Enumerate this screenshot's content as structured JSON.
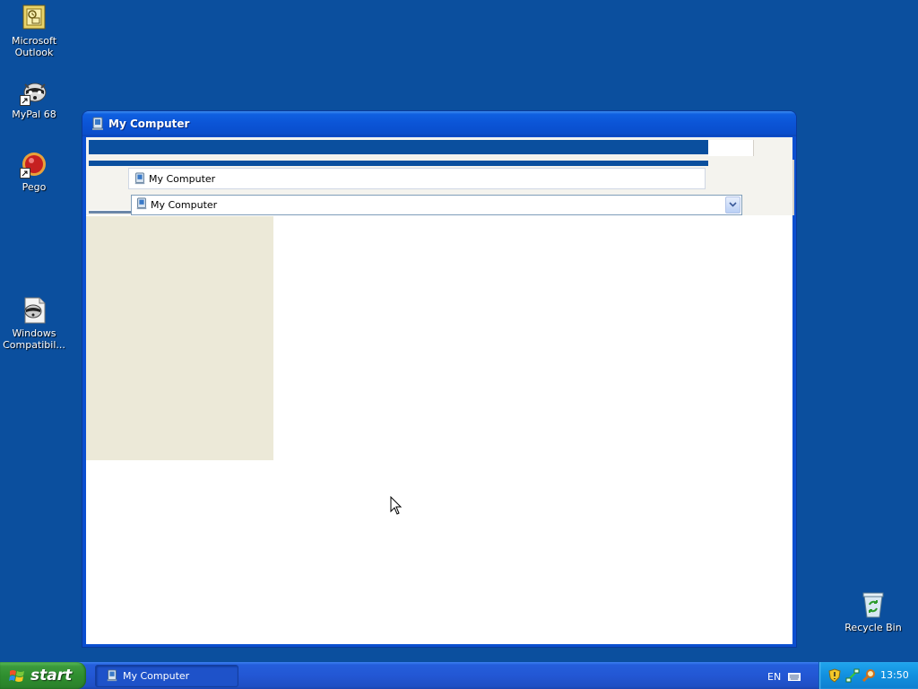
{
  "desktop": {
    "icons": [
      {
        "label_line1": "Microsoft",
        "label_line2": "Outlook",
        "icon": "outlook-icon"
      },
      {
        "label_line1": "MyPal 68",
        "label_line2": "",
        "icon": "raccoon-icon"
      },
      {
        "label_line1": "Pego",
        "label_line2": "",
        "icon": "pego-icon"
      },
      {
        "label_line1": "Windows",
        "label_line2": "Compatibil...",
        "icon": "compat-icon"
      },
      {
        "label_line1": "Recycle Bin",
        "label_line2": "",
        "icon": "recycle-bin-icon"
      }
    ]
  },
  "window": {
    "title": "My Computer",
    "address_text": "My Computer",
    "combo_value": "My Computer"
  },
  "taskbar": {
    "start_label": "start",
    "task_label": "My Computer",
    "language": "EN",
    "clock": "13:50"
  },
  "colors": {
    "desktop": "#0b4f9e",
    "titlebar": "#0b54d6",
    "start": "#2f8f2f",
    "tray": "#1290df"
  }
}
